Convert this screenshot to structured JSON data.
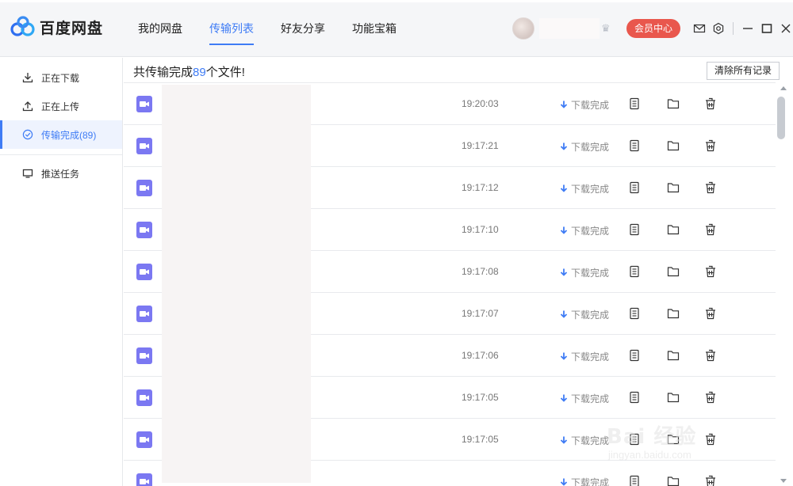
{
  "app": {
    "name": "百度网盘",
    "brand_color": "#3f7cf5"
  },
  "nav": {
    "tabs": [
      {
        "label": "我的网盘",
        "active": false
      },
      {
        "label": "传输列表",
        "active": true
      },
      {
        "label": "好友分享",
        "active": false
      },
      {
        "label": "功能宝箱",
        "active": false
      }
    ]
  },
  "user": {
    "vip_label": "会员中心",
    "vip_color": "#e9574d"
  },
  "sidebar": {
    "items": [
      {
        "label": "正在下载",
        "icon": "download-icon"
      },
      {
        "label": "正在上传",
        "icon": "upload-icon"
      },
      {
        "label": "传输完成(89)",
        "icon": "check-circle-icon",
        "active": true
      },
      {
        "label": "推送任务",
        "icon": "monitor-icon"
      }
    ]
  },
  "main": {
    "summary_prefix": "共传输完成",
    "summary_count": "89",
    "summary_suffix": "个文件!",
    "clear_label": "清除所有记录"
  },
  "transfers": [
    {
      "time": "19:20:03",
      "status": "下载完成"
    },
    {
      "time": "19:17:21",
      "status": "下载完成"
    },
    {
      "time": "19:17:12",
      "status": "下载完成"
    },
    {
      "time": "19:17:10",
      "status": "下载完成"
    },
    {
      "time": "19:17:08",
      "status": "下载完成"
    },
    {
      "time": "19:17:07",
      "status": "下载完成"
    },
    {
      "time": "19:17:06",
      "status": "下载完成"
    },
    {
      "time": "19:17:05",
      "status": "下载完成"
    },
    {
      "time": "19:17:05",
      "status": "下载完成"
    },
    {
      "time": "",
      "status": "下载完成"
    }
  ],
  "watermark": {
    "brand": "Bai 经验",
    "url": "jingyan.baidu.com"
  }
}
